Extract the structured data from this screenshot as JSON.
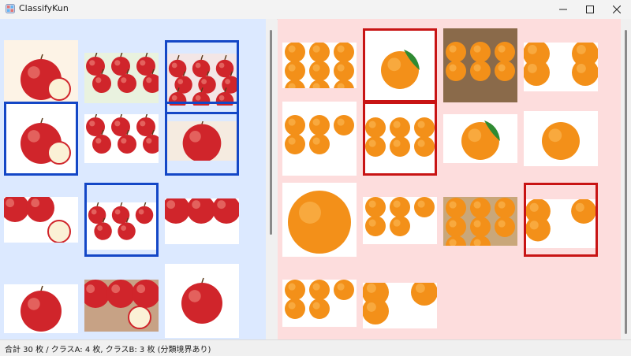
{
  "window": {
    "title": "ClassifyKun"
  },
  "colors": {
    "panel_a_bg": "#dce9ff",
    "panel_b_bg": "#fddddd",
    "select_a": "#1447c6",
    "select_b": "#c81414"
  },
  "class_a": {
    "items": [
      {
        "subject": "apple",
        "selected": false
      },
      {
        "subject": "apple",
        "selected": false
      },
      {
        "subject": "apple",
        "selected": true
      },
      {
        "subject": "apple",
        "selected": true
      },
      {
        "subject": "apple",
        "selected": false
      },
      {
        "subject": "apple",
        "selected": true
      },
      {
        "subject": "apple",
        "selected": false
      },
      {
        "subject": "apple",
        "selected": true
      },
      {
        "subject": "apple",
        "selected": false
      },
      {
        "subject": "apple",
        "selected": false
      },
      {
        "subject": "apple",
        "selected": false
      },
      {
        "subject": "apple",
        "selected": false
      }
    ]
  },
  "class_b": {
    "items": [
      {
        "subject": "orange",
        "selected": false
      },
      {
        "subject": "orange",
        "selected": true
      },
      {
        "subject": "orange",
        "selected": false
      },
      {
        "subject": "orange",
        "selected": false
      },
      {
        "subject": "orange",
        "selected": false
      },
      {
        "subject": "orange",
        "selected": true
      },
      {
        "subject": "orange",
        "selected": false
      },
      {
        "subject": "orange",
        "selected": false
      },
      {
        "subject": "orange",
        "selected": false
      },
      {
        "subject": "orange",
        "selected": false
      },
      {
        "subject": "orange",
        "selected": false
      },
      {
        "subject": "orange",
        "selected": true
      },
      {
        "subject": "orange",
        "selected": false
      },
      {
        "subject": "orange",
        "selected": false
      }
    ]
  },
  "status": {
    "text": "合計 30 枚 / クラスA: 4 枚, クラスB: 3 枚 (分類境界あり)"
  }
}
